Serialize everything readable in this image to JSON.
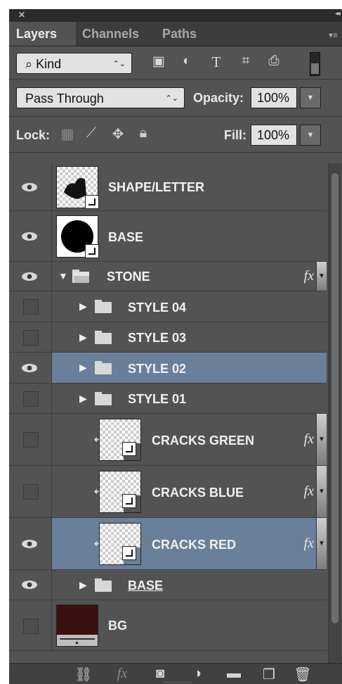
{
  "panel": {
    "close_glyph": "✕",
    "collapse_glyph": "◂◂",
    "tabs": [
      "Layers",
      "Channels",
      "Paths"
    ],
    "active_tab": "Layers"
  },
  "filter": {
    "kind_label": "Kind",
    "select_arrows": "⌃⌄"
  },
  "blend": {
    "mode": "Pass Through",
    "opacity_label": "Opacity:",
    "opacity_value": "100%",
    "lock_label": "Lock:",
    "fill_label": "Fill:",
    "fill_value": "100%"
  },
  "layers": [
    {
      "name": "SHAPE/LETTER",
      "visible": true,
      "type": "smart"
    },
    {
      "name": "BASE",
      "visible": true,
      "type": "smart"
    },
    {
      "name": "STONE",
      "visible": true,
      "type": "group-open",
      "fx": "fx"
    },
    {
      "name": "STYLE 04",
      "visible": false,
      "type": "group"
    },
    {
      "name": "STYLE 03",
      "visible": false,
      "type": "group"
    },
    {
      "name": "STYLE 02",
      "visible": true,
      "type": "group",
      "selected": true
    },
    {
      "name": "STYLE 01",
      "visible": false,
      "type": "group"
    },
    {
      "name": "CRACKS GREEN",
      "visible": false,
      "type": "clipped-smart",
      "fx": "fx"
    },
    {
      "name": "CRACKS BLUE",
      "visible": false,
      "type": "clipped-smart",
      "fx": "fx"
    },
    {
      "name": "CRACKS RED",
      "visible": true,
      "type": "clipped-smart",
      "fx": "fx",
      "selected": true
    },
    {
      "name": "BASE",
      "visible": true,
      "type": "group"
    },
    {
      "name": "BG",
      "visible": false,
      "type": "fill"
    }
  ],
  "colors": {
    "panel_bg": "#535353",
    "selected_row": "#6a7f99",
    "bg_swatch": "#3a1010"
  },
  "footer": {
    "icons": [
      "link-icon",
      "fx-icon",
      "mask-icon",
      "adjustment-icon",
      "group-icon",
      "new-layer-icon",
      "trash-icon"
    ],
    "fx_label": "fx"
  }
}
